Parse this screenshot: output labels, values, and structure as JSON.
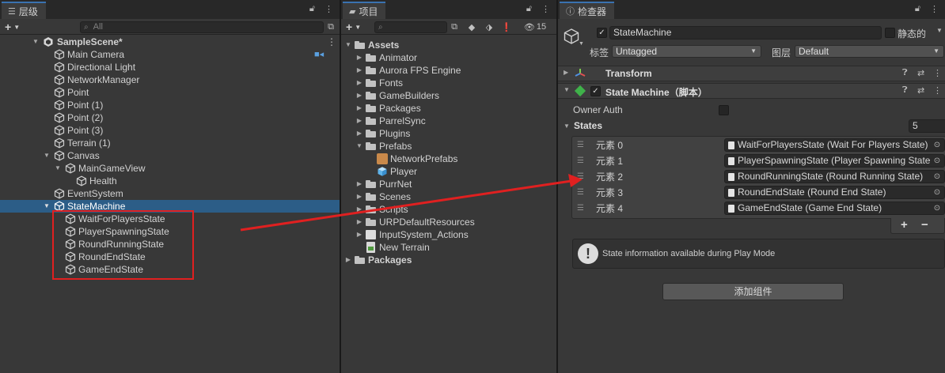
{
  "hierarchy": {
    "tab_label": "层级",
    "search_placeholder": "All",
    "scene": "SampleScene*",
    "items": [
      {
        "label": "Main Camera"
      },
      {
        "label": "Directional Light"
      },
      {
        "label": "NetworkManager"
      },
      {
        "label": "Point"
      },
      {
        "label": "Point (1)"
      },
      {
        "label": "Point (2)"
      },
      {
        "label": "Point (3)"
      },
      {
        "label": "Terrain (1)"
      },
      {
        "label": "Canvas"
      },
      {
        "label": "MainGameView"
      },
      {
        "label": "Health"
      },
      {
        "label": "EventSystem"
      },
      {
        "label": "StateMachine"
      },
      {
        "label": "WaitForPlayersState"
      },
      {
        "label": "PlayerSpawningState"
      },
      {
        "label": "RoundRunningState"
      },
      {
        "label": "RoundEndState"
      },
      {
        "label": "GameEndState"
      }
    ]
  },
  "project": {
    "tab_label": "项目",
    "hidden_count": "15",
    "items": [
      {
        "label": "Assets"
      },
      {
        "label": "Animator"
      },
      {
        "label": "Aurora FPS Engine"
      },
      {
        "label": "Fonts"
      },
      {
        "label": "GameBuilders"
      },
      {
        "label": "Packages"
      },
      {
        "label": "ParrelSync"
      },
      {
        "label": "Plugins"
      },
      {
        "label": "Prefabs"
      },
      {
        "label": "NetworkPrefabs"
      },
      {
        "label": "Player"
      },
      {
        "label": "PurrNet"
      },
      {
        "label": "Scenes"
      },
      {
        "label": "Scripts"
      },
      {
        "label": "URPDefaultResources"
      },
      {
        "label": "InputSystem_Actions"
      },
      {
        "label": "New Terrain"
      },
      {
        "label": "Packages"
      }
    ]
  },
  "inspector": {
    "tab_label": "检查器",
    "object_name": "StateMachine",
    "static_label": "静态的",
    "tag_label": "标签",
    "tag_value": "Untagged",
    "layer_label": "图层",
    "layer_value": "Default",
    "transform_label": "Transform",
    "component_label": "State Machine（脚本）",
    "owner_auth_label": "Owner Auth",
    "states_label": "States",
    "states_count": "5",
    "elements": [
      {
        "label": "元素 0",
        "value": "WaitForPlayersState (Wait For Players State)"
      },
      {
        "label": "元素 1",
        "value": "PlayerSpawningState (Player Spawning State)"
      },
      {
        "label": "元素 2",
        "value": "RoundRunningState (Round Running State)"
      },
      {
        "label": "元素 3",
        "value": "RoundEndState (Round End State)"
      },
      {
        "label": "元素 4",
        "value": "GameEndState (Game End State)"
      }
    ],
    "help_text": "State information available during Play Mode",
    "add_component_label": "添加组件"
  }
}
